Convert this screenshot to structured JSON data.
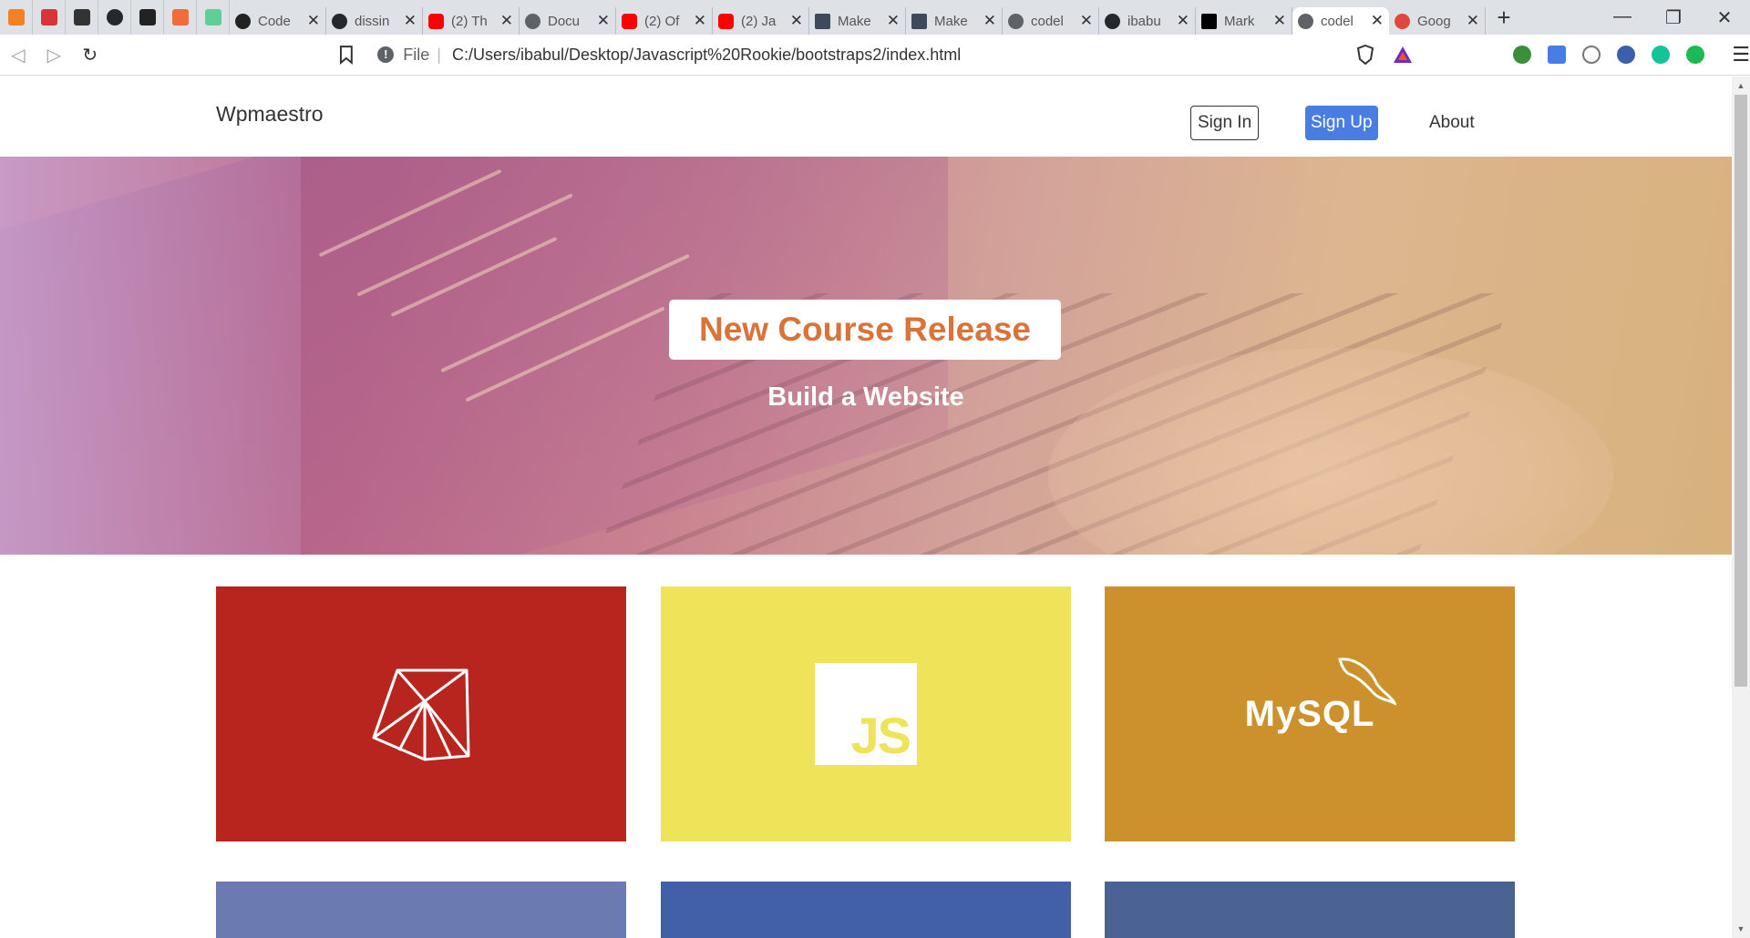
{
  "browser": {
    "tabs": [
      {
        "label": "Code",
        "color": "#222222"
      },
      {
        "label": "dissin",
        "color": "#24292e"
      },
      {
        "label": "(2) Th",
        "color": "#ff0000"
      },
      {
        "label": "Docu",
        "color": "#5f6368"
      },
      {
        "label": "(2) Of",
        "color": "#ff0000"
      },
      {
        "label": "(2) Ja",
        "color": "#ff0000"
      },
      {
        "label": "Make",
        "color": "#3c4a5c"
      },
      {
        "label": "Make",
        "color": "#3c4a5c"
      },
      {
        "label": "codel",
        "color": "#5f6368"
      },
      {
        "label": "ibabu",
        "color": "#24292e"
      },
      {
        "label": "Mark",
        "color": "#000000"
      },
      {
        "label": "codel",
        "color": "#5f6368"
      },
      {
        "label": "Goog",
        "color": "#e0483e"
      }
    ],
    "active_tab_index": 11,
    "scheme": "File",
    "url": "C:/Users/ibabul/Desktop/Javascript%20Rookie/bootstraps2/index.html"
  },
  "site": {
    "brand": "Wpmaestro",
    "nav": {
      "signin": "Sign In",
      "signup": "Sign Up",
      "about": "About"
    },
    "hero": {
      "badge": "New Course Release",
      "subtitle": "Build a Website"
    },
    "cards": [
      {
        "name": "ruby",
        "color": "#b8241e"
      },
      {
        "name": "javascript",
        "color": "#efe35a",
        "logo_text": "JS"
      },
      {
        "name": "mysql",
        "color": "#cc912c",
        "logo_text": "MySQL"
      }
    ],
    "cards_row2": [
      {
        "color": "#6c7ab2"
      },
      {
        "color": "#4260a8"
      },
      {
        "color": "#4a6294"
      }
    ]
  }
}
